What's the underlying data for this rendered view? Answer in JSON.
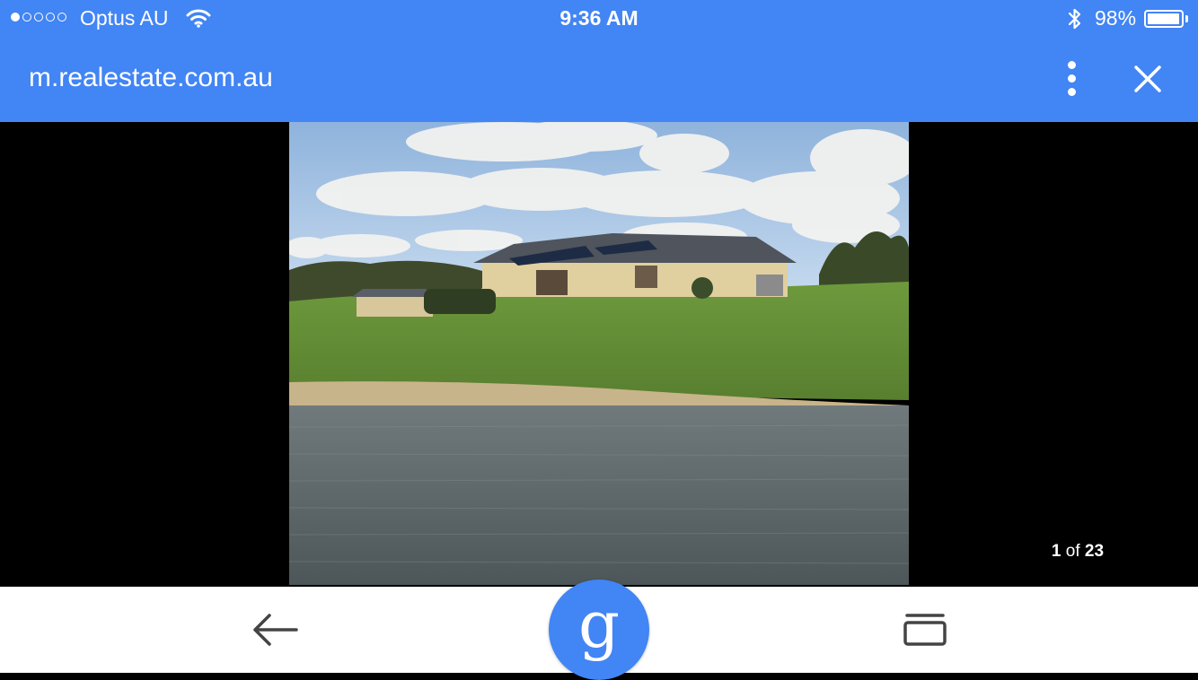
{
  "status_bar": {
    "signal_dots_filled": 1,
    "signal_dots_total": 5,
    "carrier": "Optus AU",
    "time": "9:36 AM",
    "battery_percent": "98%",
    "battery_level": 0.98,
    "icons": [
      "wifi-icon",
      "bluetooth-icon",
      "battery-icon"
    ]
  },
  "url_bar": {
    "url": "m.realestate.com.au",
    "icons": [
      "more-vert-icon",
      "close-icon"
    ]
  },
  "image_viewer": {
    "current": "1",
    "of_label": "of",
    "total": "23"
  },
  "bottom_bar": {
    "icons": [
      "back-arrow-icon",
      "google-g-icon",
      "tabs-icon"
    ],
    "google_letter": "g"
  },
  "colors": {
    "accent": "#4285f4",
    "viewer_bg": "#000000",
    "bottom_bg": "#ffffff"
  }
}
